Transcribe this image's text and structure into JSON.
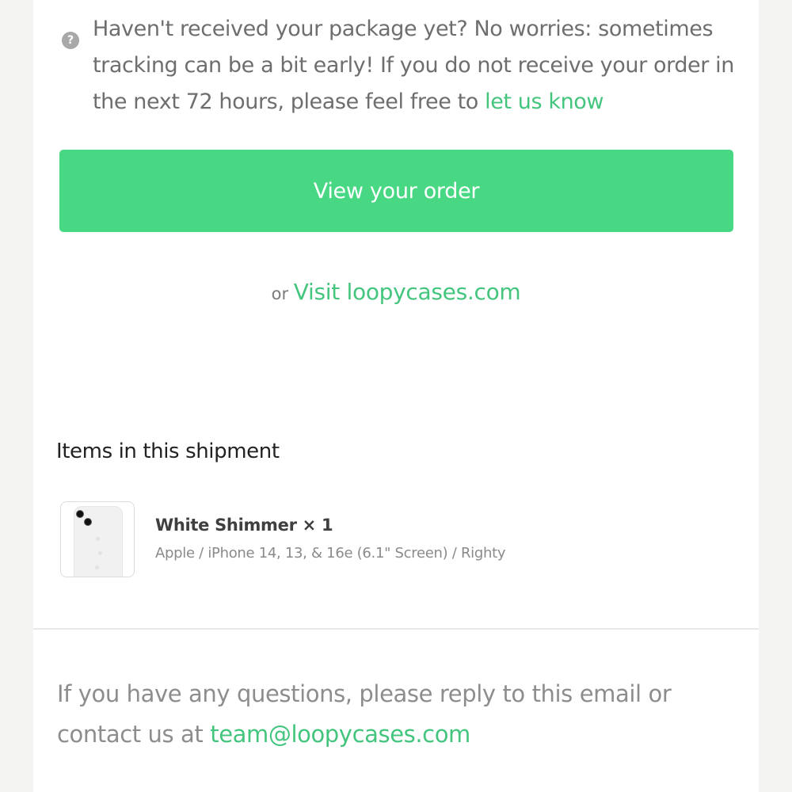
{
  "notice": {
    "icon": "question-circle-icon",
    "text": "Haven't received your package yet? No worries: sometimes tracking can be a bit early! If you do not receive your order in the next 72 hours, please feel free to ",
    "link_text": "let us know"
  },
  "cta": {
    "label": "View your order"
  },
  "visit": {
    "prefix": "or",
    "link_text": "Visit loopycases.com"
  },
  "items": {
    "title": "Items in this shipment",
    "list": [
      {
        "name": "White Shimmer × 1",
        "variant": "Apple / iPhone 14, 13, & 16e (6.1\" Screen) / Righty",
        "thumbnail_icon": "phone-case-icon"
      }
    ]
  },
  "footer": {
    "text": "If you have any questions, please reply to this email or contact us at ",
    "email": "team@loopycases.com"
  },
  "colors": {
    "accent": "#48d884",
    "link": "#44c57e",
    "background": "#f4f4f2"
  }
}
